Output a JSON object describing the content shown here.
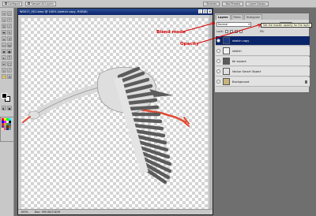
{
  "options_bar": {
    "items": [
      "Configure",
      "Sample All Layers"
    ],
    "right_tabs": [
      "Brushes",
      "Tool Presets",
      "Layer Comps"
    ]
  },
  "document": {
    "title": "W0017_001.bmp @ 100% (sketch copy, RGB/8)",
    "status_zoom": "100%",
    "status_doc": "Doc: 395.0K/3.81M"
  },
  "layers_panel": {
    "tabs": [
      "Layers",
      "Paths",
      "Histogram"
    ],
    "blend_mode": "Normal",
    "opacity_label": "Opacity:",
    "opacity_value": "100%",
    "lock_label": "Lock:",
    "fill_label": "Fill:",
    "tooltip": "Set the master opacity for the layer",
    "layers": [
      {
        "name": "sketch copy",
        "selected": true,
        "thumb_color": "#1a3a8a"
      },
      {
        "name": "sketch",
        "selected": false,
        "thumb_color": "#f2f2f2"
      },
      {
        "name": "bk square",
        "selected": false,
        "thumb_color": "#5a5a5a"
      },
      {
        "name": "Vector Smart Object",
        "selected": false,
        "thumb_color": "#e0e0e0"
      },
      {
        "name": "Background",
        "selected": false,
        "thumb_color": "#c9b37a"
      }
    ]
  },
  "annotations": {
    "blend_mode": "Blend mode",
    "opacity": "Opacity"
  },
  "colors": {
    "annotation_red": "#d40000",
    "selection_blue": "#0a246a",
    "bird_body": "#dcdcdc",
    "bird_feather": "#5c5c5c",
    "bird_beak": "#e24a33"
  }
}
